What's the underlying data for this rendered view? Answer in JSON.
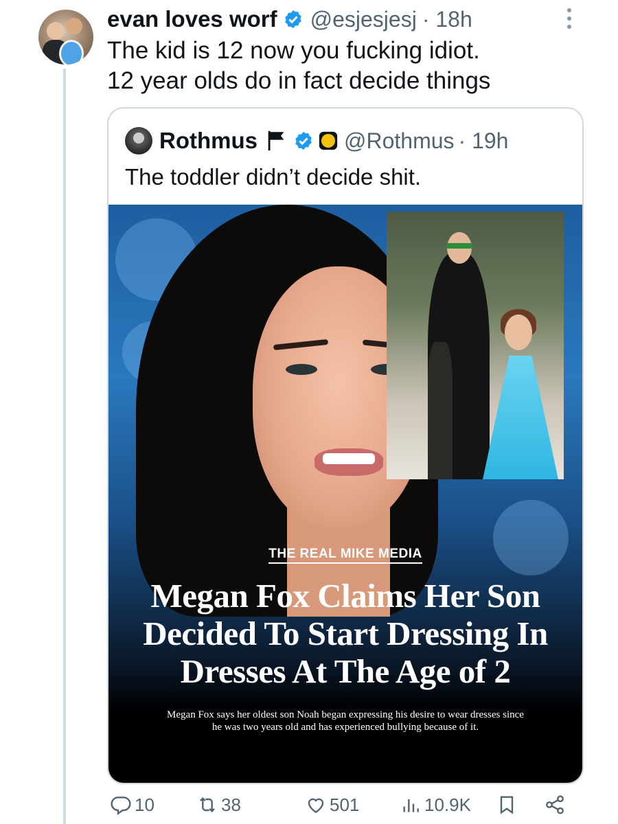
{
  "tweet": {
    "display_name": "evan loves worf",
    "handle": "@esjesjesj",
    "time": "· 18h",
    "text_lines": [
      "The kid is 12 now you fucking idiot.",
      "12 year olds do in fact decide things"
    ]
  },
  "quoted": {
    "display_name": "Rothmus",
    "handle": "@Rothmus",
    "time": "· 19h",
    "text": "The toddler didn’t decide shit.",
    "media": {
      "source": "THE REAL MIKE MEDIA",
      "headline_lines": [
        "Megan Fox Claims Her Son",
        "Decided To Start Dressing In",
        "Dresses At The Age of 2"
      ],
      "subhead_lines": [
        "Megan Fox says her oldest son Noah began expressing his desire to wear dresses since",
        "he was two years old and has experienced bullying because of it."
      ]
    }
  },
  "actions": {
    "replies": "10",
    "reposts": "38",
    "likes": "501",
    "views": "10.9K"
  },
  "colors": {
    "verified": "#1d9bf0",
    "muted": "#536471",
    "border": "#cfd9de"
  }
}
